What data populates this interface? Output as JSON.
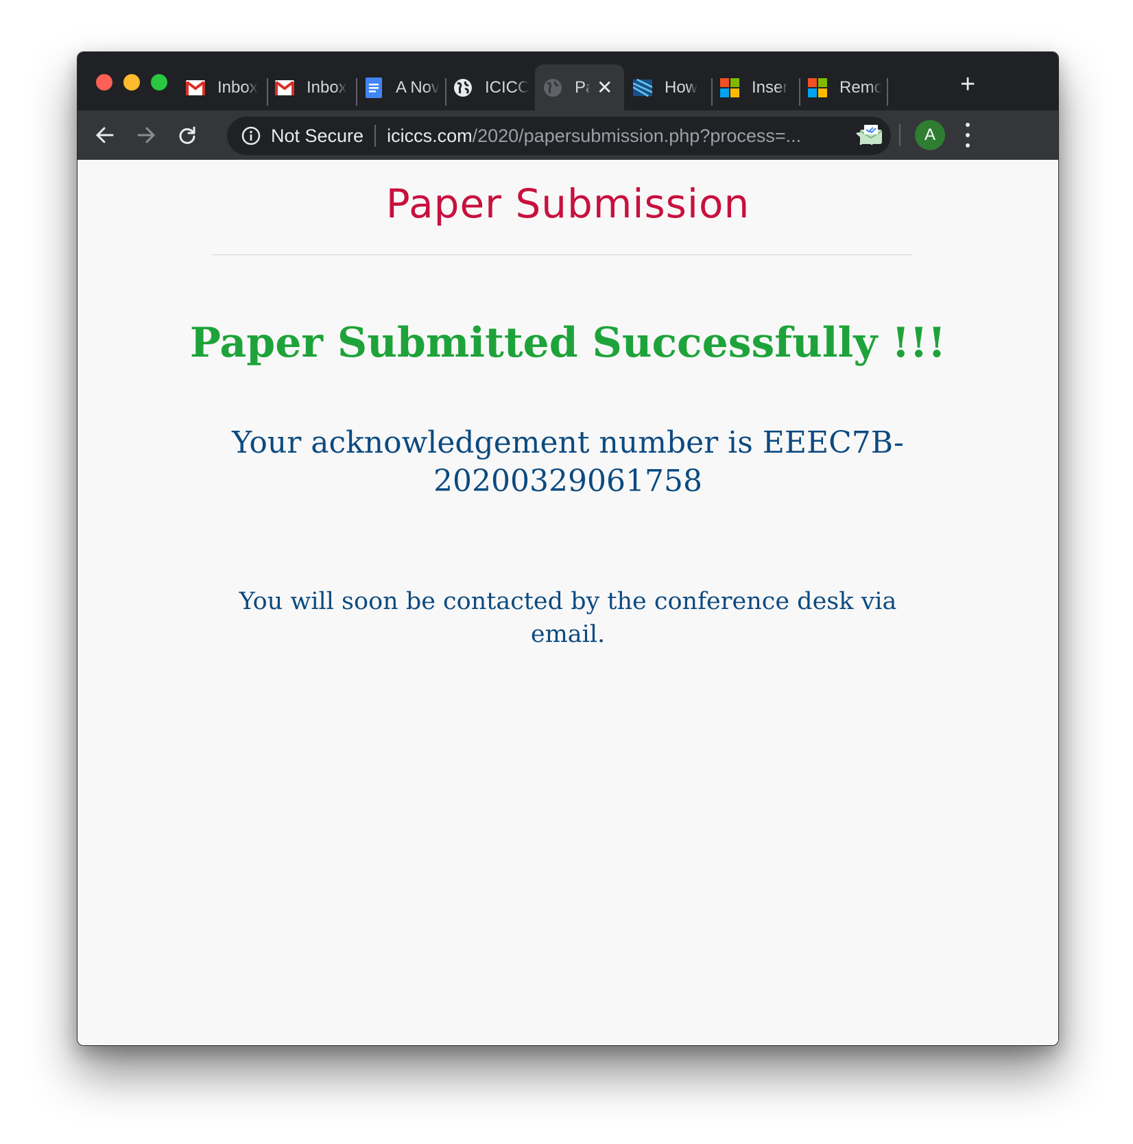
{
  "browser": {
    "tabs": [
      {
        "label": "Inbox",
        "icon": "gmail-icon"
      },
      {
        "label": "Inbox",
        "icon": "gmail-icon"
      },
      {
        "label": "A Nov",
        "icon": "google-docs-icon"
      },
      {
        "label": "ICICC",
        "icon": "globe-icon"
      },
      {
        "label": "Pa",
        "icon": "globe-icon",
        "active": true
      },
      {
        "label": "How",
        "icon": "site-favicon-icon"
      },
      {
        "label": "Inser",
        "icon": "microsoft-icon"
      },
      {
        "label": "Remo",
        "icon": "microsoft-icon"
      }
    ],
    "new_tab_label": "+",
    "security_label": "Not Secure",
    "url_host": "iciccs.com",
    "url_path": "/2020/papersubmission.php?process=...",
    "avatar_initial": "A",
    "colors": {
      "tab_strip": "#202124",
      "toolbar": "#35363a",
      "avatar": "#2e7d32"
    }
  },
  "page": {
    "title": "Paper Submission",
    "success_message": "Paper Submitted Successfully !!!",
    "ack_line1": "Your acknowledgement number is EEEC7B-",
    "ack_line2": "20200329061758",
    "contact_message": "You will soon be contacted by the conference desk via email.",
    "colors": {
      "title": "#c8103e",
      "success": "#1ea33a",
      "body_text": "#0c4a80"
    }
  }
}
